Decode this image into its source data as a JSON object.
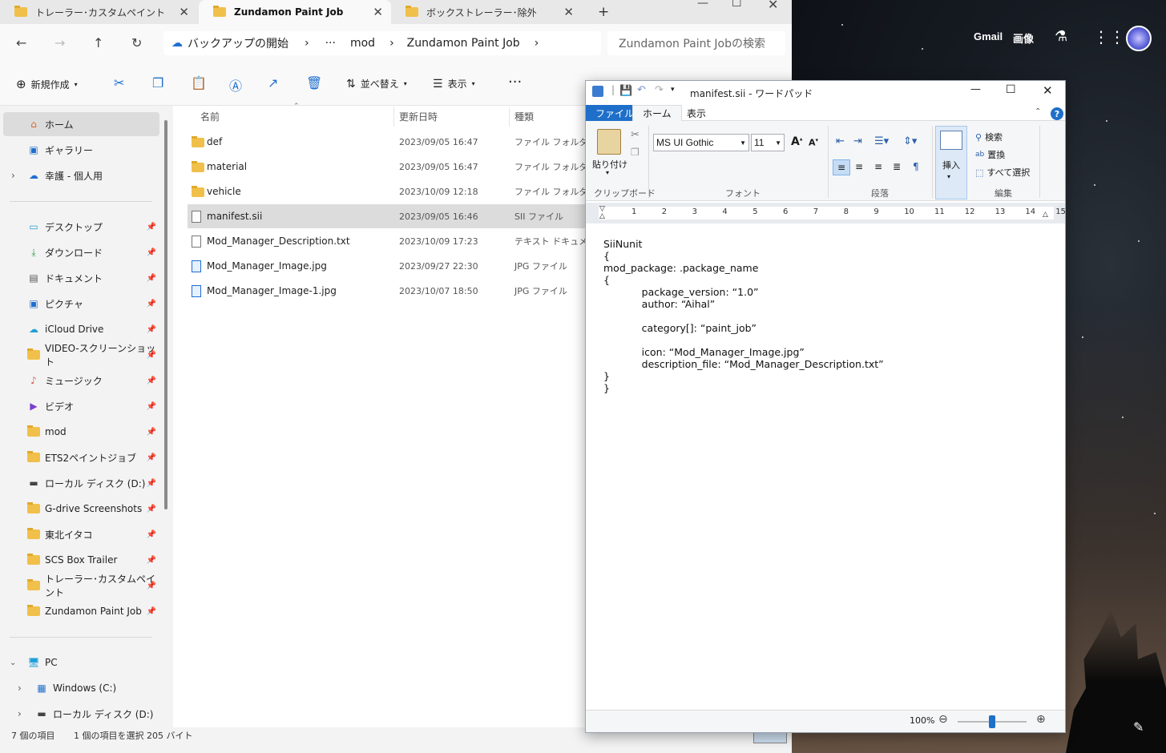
{
  "browser": {
    "gmail": "Gmail",
    "images": "画像"
  },
  "explorer": {
    "tabs": [
      {
        "label": "トレーラー･カスタムペイント"
      },
      {
        "label": "Zundamon Paint Job"
      },
      {
        "label": "ボックストレーラー･除外"
      }
    ],
    "breadcrumb": {
      "root": "バックアップの開始",
      "ellipsis": "···",
      "mod": "mod",
      "current": "Zundamon Paint Job"
    },
    "search_placeholder": "Zundamon Paint Jobの検索",
    "toolbar": {
      "new": "新規作成",
      "sort": "並べ替え",
      "view": "表示"
    },
    "sidebar": {
      "home": "ホーム",
      "gallery": "ギャラリー",
      "onedrive": "幸護 - 個人用",
      "quick": [
        {
          "label": "デスクトップ"
        },
        {
          "label": "ダウンロード"
        },
        {
          "label": "ドキュメント"
        },
        {
          "label": "ピクチャ"
        },
        {
          "label": "iCloud Drive"
        },
        {
          "label": "VIDEO-スクリーンショット"
        },
        {
          "label": "ミュージック"
        },
        {
          "label": "ビデオ"
        },
        {
          "label": "mod"
        },
        {
          "label": "ETS2ペイントジョブ"
        },
        {
          "label": "ローカル ディスク (D:)"
        },
        {
          "label": "G-drive Screenshots"
        },
        {
          "label": "東北イタコ"
        },
        {
          "label": "SCS Box Trailer"
        },
        {
          "label": "トレーラー･カスタムペイント"
        },
        {
          "label": "Zundamon Paint Job"
        }
      ],
      "pc": "PC",
      "drives": [
        {
          "label": "Windows (C:)"
        },
        {
          "label": "ローカル ディスク (D:)"
        }
      ]
    },
    "columns": {
      "name": "名前",
      "date": "更新日時",
      "type": "種類"
    },
    "files": [
      {
        "name": "def",
        "date": "2023/09/05 16:47",
        "type": "ファイル フォルダー"
      },
      {
        "name": "material",
        "date": "2023/09/05 16:47",
        "type": "ファイル フォルダー"
      },
      {
        "name": "vehicle",
        "date": "2023/10/09 12:18",
        "type": "ファイル フォルダー"
      },
      {
        "name": "manifest.sii",
        "date": "2023/09/05 16:46",
        "type": "SII ファイル"
      },
      {
        "name": "Mod_Manager_Description.txt",
        "date": "2023/10/09 17:23",
        "type": "テキスト ドキュメント"
      },
      {
        "name": "Mod_Manager_Image.jpg",
        "date": "2023/09/27 22:30",
        "type": "JPG ファイル"
      },
      {
        "name": "Mod_Manager_Image-1.jpg",
        "date": "2023/10/07 18:50",
        "type": "JPG ファイル"
      }
    ],
    "status": {
      "count": "7 個の項目",
      "selected": "1 個の項目を選択  205 バイト"
    }
  },
  "wordpad": {
    "title": "manifest.sii - ワードパッド",
    "tabs": {
      "file": "ファイル",
      "home": "ホーム",
      "view": "表示"
    },
    "clipboard": {
      "paste": "貼り付け",
      "group": "クリップボード"
    },
    "font": {
      "name": "MS UI Gothic",
      "size": "11",
      "group": "フォント"
    },
    "paragraph": {
      "group": "段落"
    },
    "insert": {
      "label": "挿入"
    },
    "edit": {
      "find": "検索",
      "replace": "置換",
      "select_all": "すべて選択",
      "group": "編集"
    },
    "ruler": [
      "1",
      "2",
      "3",
      "4",
      "5",
      "6",
      "7",
      "8",
      "9",
      "10",
      "11",
      "12",
      "13",
      "14",
      "15"
    ],
    "doc_lines": [
      "SiiNunit",
      "{",
      "mod_package: .package_name",
      "{",
      "            package_version: “1.0”",
      "            author: “Aihal”",
      "",
      "            category[]: “paint_job”",
      "",
      "            icon: “Mod_Manager_Image.jpg”",
      "            description_file: “Mod_Manager_Description.txt”",
      "}",
      "}"
    ],
    "zoom": "100%"
  },
  "colors": {
    "accent": "#1e6fc9",
    "folder": "#f0c04a"
  }
}
